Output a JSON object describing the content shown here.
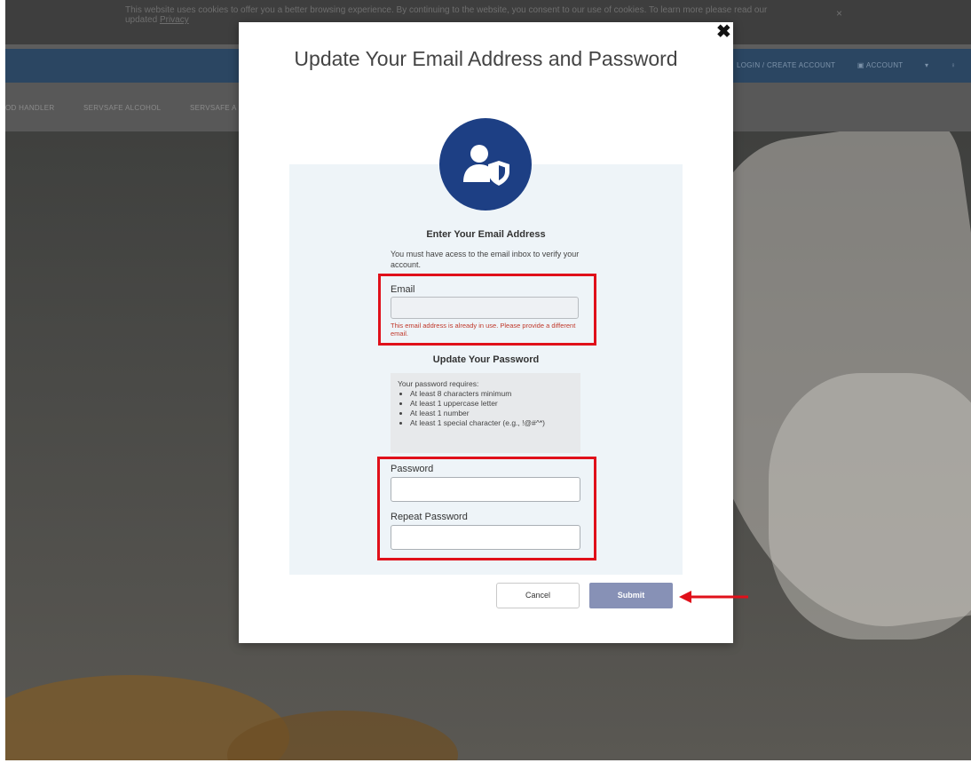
{
  "cookie": {
    "text": "This website uses cookies to offer you a better browsing experience. By continuing to the website, you consent to our use of cookies. To learn more please read our updated ",
    "link": "Privacy",
    "close": "×"
  },
  "header": {
    "login": "LOGIN / CREATE ACCOUNT",
    "account": "ACCOUNT"
  },
  "nav": {
    "items": [
      "OD HANDLER",
      "SERVSAFE ALCOHOL",
      "SERVSAFE A"
    ]
  },
  "modal": {
    "close": "✖",
    "title": "Update Your Email Address and Password",
    "email_section": {
      "title": "Enter Your Email Address",
      "help": "You must have acess to the email inbox to verify your account.",
      "label": "Email",
      "value": "",
      "error": "This email address is already in use. Please provide a different email."
    },
    "password_section": {
      "title": "Update Your Password",
      "requirements_title": "Your password requires:",
      "requirements": [
        "At least 8 characters minimum",
        "At least 1 uppercase letter",
        "At least 1 number",
        "At least 1 special character (e.g., !@#^*)"
      ],
      "password_label": "Password",
      "password_value": "",
      "repeat_label": "Repeat Password",
      "repeat_value": ""
    },
    "buttons": {
      "cancel": "Cancel",
      "submit": "Submit"
    }
  },
  "colors": {
    "modal_icon_bg": "#1d3f84",
    "submit_bg": "#8791b6",
    "highlight": "#e0101a",
    "error_text": "#c0392b"
  }
}
